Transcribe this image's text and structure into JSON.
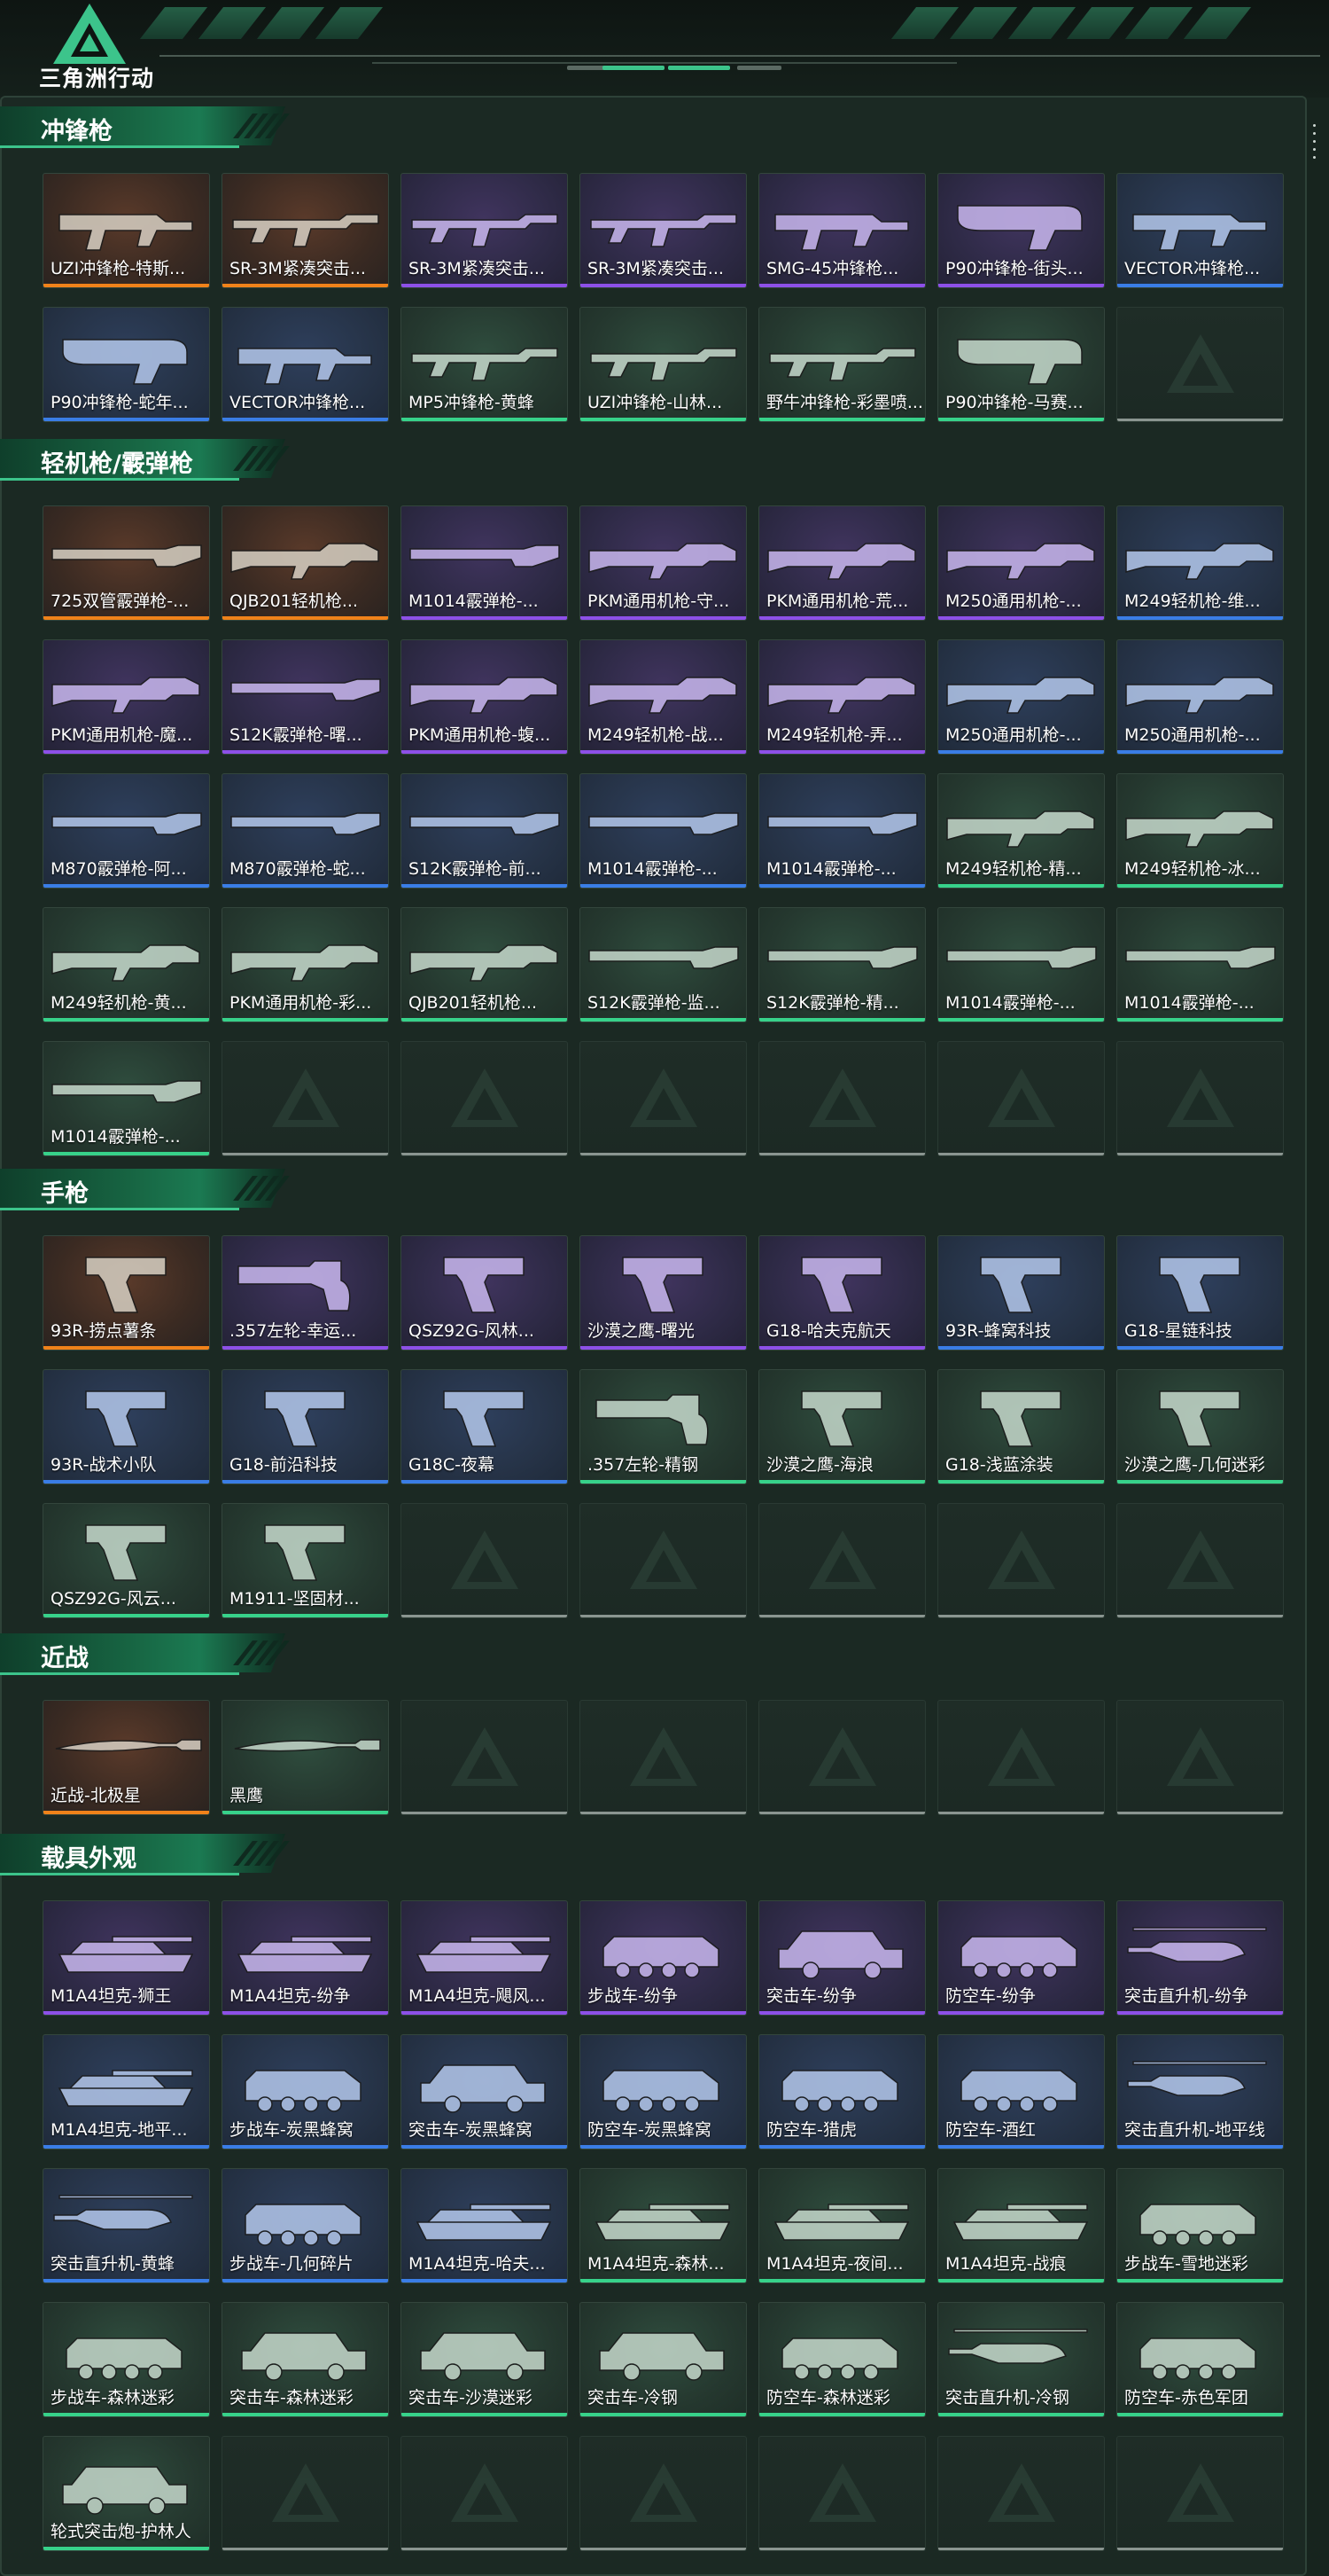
{
  "app": {
    "logo_text": "三角洲行动"
  },
  "colors": {
    "orange": "#f0821a",
    "purple": "#8d50e8",
    "blue": "#3a7de6",
    "green": "#37d28a",
    "empty": "#8a9590",
    "accent": "#1b7a52"
  },
  "sections": [
    {
      "title": "冲锋枪",
      "items": [
        {
          "name": "UZI冲锋枪-特斯...",
          "rarity": "orange",
          "kind": "smg"
        },
        {
          "name": "SR-3M紧凑突击...",
          "rarity": "orange",
          "kind": "rifle"
        },
        {
          "name": "SR-3M紧凑突击...",
          "rarity": "purple",
          "kind": "rifle"
        },
        {
          "name": "SR-3M紧凑突击...",
          "rarity": "purple",
          "kind": "rifle"
        },
        {
          "name": "SMG-45冲锋枪...",
          "rarity": "purple",
          "kind": "smg"
        },
        {
          "name": "P90冲锋枪-街头...",
          "rarity": "purple",
          "kind": "p90"
        },
        {
          "name": "VECTOR冲锋枪...",
          "rarity": "blue",
          "kind": "smg"
        },
        {
          "name": "P90冲锋枪-蛇年...",
          "rarity": "blue",
          "kind": "p90"
        },
        {
          "name": "VECTOR冲锋枪...",
          "rarity": "blue",
          "kind": "smg"
        },
        {
          "name": "MP5冲锋枪-黄蜂",
          "rarity": "green",
          "kind": "rifle"
        },
        {
          "name": "UZI冲锋枪-山林...",
          "rarity": "green",
          "kind": "rifle"
        },
        {
          "name": "野牛冲锋枪-彩墨喷...",
          "rarity": "green",
          "kind": "rifle"
        },
        {
          "name": "P90冲锋枪-马赛...",
          "rarity": "green",
          "kind": "p90"
        },
        {
          "empty": true
        }
      ]
    },
    {
      "title": "轻机枪/霰弹枪",
      "items": [
        {
          "name": "725双管霰弹枪-...",
          "rarity": "orange",
          "kind": "shotgun"
        },
        {
          "name": "QJB201轻机枪...",
          "rarity": "orange",
          "kind": "lmg"
        },
        {
          "name": "M1014霰弹枪-...",
          "rarity": "purple",
          "kind": "shotgun"
        },
        {
          "name": "PKM通用机枪-守...",
          "rarity": "purple",
          "kind": "lmg"
        },
        {
          "name": "PKM通用机枪-荒...",
          "rarity": "purple",
          "kind": "lmg"
        },
        {
          "name": "M250通用机枪-...",
          "rarity": "purple",
          "kind": "lmg"
        },
        {
          "name": "M249轻机枪-维...",
          "rarity": "blue",
          "kind": "lmg"
        },
        {
          "name": "PKM通用机枪-魔...",
          "rarity": "purple",
          "kind": "lmg"
        },
        {
          "name": "S12K霰弹枪-曙...",
          "rarity": "purple",
          "kind": "shotgun"
        },
        {
          "name": "PKM通用机枪-蝮...",
          "rarity": "purple",
          "kind": "lmg"
        },
        {
          "name": "M249轻机枪-战...",
          "rarity": "purple",
          "kind": "lmg"
        },
        {
          "name": "M249轻机枪-弄...",
          "rarity": "purple",
          "kind": "lmg"
        },
        {
          "name": "M250通用机枪-...",
          "rarity": "blue",
          "kind": "lmg"
        },
        {
          "name": "M250通用机枪-...",
          "rarity": "blue",
          "kind": "lmg"
        },
        {
          "name": "M870霰弹枪-阿...",
          "rarity": "blue",
          "kind": "shotgun"
        },
        {
          "name": "M870霰弹枪-蛇...",
          "rarity": "blue",
          "kind": "shotgun"
        },
        {
          "name": "S12K霰弹枪-前...",
          "rarity": "blue",
          "kind": "shotgun"
        },
        {
          "name": "M1014霰弹枪-...",
          "rarity": "blue",
          "kind": "shotgun"
        },
        {
          "name": "M1014霰弹枪-...",
          "rarity": "blue",
          "kind": "shotgun"
        },
        {
          "name": "M249轻机枪-精...",
          "rarity": "green",
          "kind": "lmg"
        },
        {
          "name": "M249轻机枪-冰...",
          "rarity": "green",
          "kind": "lmg"
        },
        {
          "name": "M249轻机枪-黄...",
          "rarity": "green",
          "kind": "lmg"
        },
        {
          "name": "PKM通用机枪-彩...",
          "rarity": "green",
          "kind": "lmg"
        },
        {
          "name": "QJB201轻机枪...",
          "rarity": "green",
          "kind": "lmg"
        },
        {
          "name": "S12K霰弹枪-监...",
          "rarity": "green",
          "kind": "shotgun"
        },
        {
          "name": "S12K霰弹枪-精...",
          "rarity": "green",
          "kind": "shotgun"
        },
        {
          "name": "M1014霰弹枪-...",
          "rarity": "green",
          "kind": "shotgun"
        },
        {
          "name": "M1014霰弹枪-...",
          "rarity": "green",
          "kind": "shotgun"
        },
        {
          "name": "M1014霰弹枪-...",
          "rarity": "green",
          "kind": "shotgun"
        },
        {
          "empty": true
        },
        {
          "empty": true
        },
        {
          "empty": true
        },
        {
          "empty": true
        },
        {
          "empty": true
        },
        {
          "empty": true
        }
      ]
    },
    {
      "title": "手枪",
      "items": [
        {
          "name": "93R-捞点薯条",
          "rarity": "orange",
          "kind": "pistol"
        },
        {
          "name": ".357左轮-幸运...",
          "rarity": "purple",
          "kind": "revolver"
        },
        {
          "name": "QSZ92G-风林...",
          "rarity": "purple",
          "kind": "pistol"
        },
        {
          "name": "沙漠之鹰-曙光",
          "rarity": "purple",
          "kind": "pistol"
        },
        {
          "name": "G18-哈夫克航天",
          "rarity": "purple",
          "kind": "pistol"
        },
        {
          "name": "93R-蜂窝科技",
          "rarity": "blue",
          "kind": "pistol"
        },
        {
          "name": "G18-星链科技",
          "rarity": "blue",
          "kind": "pistol"
        },
        {
          "name": "93R-战术小队",
          "rarity": "blue",
          "kind": "pistol"
        },
        {
          "name": "G18-前沿科技",
          "rarity": "blue",
          "kind": "pistol"
        },
        {
          "name": "G18C-夜幕",
          "rarity": "blue",
          "kind": "pistol"
        },
        {
          "name": ".357左轮-精钢",
          "rarity": "green",
          "kind": "revolver"
        },
        {
          "name": "沙漠之鹰-海浪",
          "rarity": "green",
          "kind": "pistol"
        },
        {
          "name": "G18-浅蓝涂装",
          "rarity": "green",
          "kind": "pistol"
        },
        {
          "name": "沙漠之鹰-几何迷彩",
          "rarity": "green",
          "kind": "pistol"
        },
        {
          "name": "QSZ92G-风云...",
          "rarity": "green",
          "kind": "pistol"
        },
        {
          "name": "M1911-坚固材...",
          "rarity": "green",
          "kind": "pistol"
        },
        {
          "empty": true
        },
        {
          "empty": true
        },
        {
          "empty": true
        },
        {
          "empty": true
        },
        {
          "empty": true
        }
      ]
    },
    {
      "title": "近战",
      "items": [
        {
          "name": "近战-北极星",
          "rarity": "orange",
          "kind": "knife"
        },
        {
          "name": "黑鹰",
          "rarity": "green",
          "kind": "knife"
        },
        {
          "empty": true
        },
        {
          "empty": true
        },
        {
          "empty": true
        },
        {
          "empty": true
        },
        {
          "empty": true
        }
      ]
    },
    {
      "title": "载具外观",
      "items": [
        {
          "name": "M1A4坦克-狮王",
          "rarity": "purple",
          "kind": "tank"
        },
        {
          "name": "M1A4坦克-纷争",
          "rarity": "purple",
          "kind": "tank"
        },
        {
          "name": "M1A4坦克-飓风...",
          "rarity": "purple",
          "kind": "tank"
        },
        {
          "name": "步战车-纷争",
          "rarity": "purple",
          "kind": "ifv"
        },
        {
          "name": "突击车-纷争",
          "rarity": "purple",
          "kind": "car"
        },
        {
          "name": "防空车-纷争",
          "rarity": "purple",
          "kind": "ifv"
        },
        {
          "name": "突击直升机-纷争",
          "rarity": "purple",
          "kind": "heli"
        },
        {
          "name": "M1A4坦克-地平...",
          "rarity": "blue",
          "kind": "tank"
        },
        {
          "name": "步战车-炭黑蜂窝",
          "rarity": "blue",
          "kind": "ifv"
        },
        {
          "name": "突击车-炭黑蜂窝",
          "rarity": "blue",
          "kind": "car"
        },
        {
          "name": "防空车-炭黑蜂窝",
          "rarity": "blue",
          "kind": "ifv"
        },
        {
          "name": "防空车-猎虎",
          "rarity": "blue",
          "kind": "ifv"
        },
        {
          "name": "防空车-酒红",
          "rarity": "blue",
          "kind": "ifv"
        },
        {
          "name": "突击直升机-地平线",
          "rarity": "blue",
          "kind": "heli"
        },
        {
          "name": "突击直升机-黄蜂",
          "rarity": "blue",
          "kind": "heli"
        },
        {
          "name": "步战车-几何碎片",
          "rarity": "blue",
          "kind": "ifv"
        },
        {
          "name": "M1A4坦克-哈夫...",
          "rarity": "blue",
          "kind": "tank"
        },
        {
          "name": "M1A4坦克-森林...",
          "rarity": "green",
          "kind": "tank"
        },
        {
          "name": "M1A4坦克-夜间...",
          "rarity": "green",
          "kind": "tank"
        },
        {
          "name": "M1A4坦克-战痕",
          "rarity": "green",
          "kind": "tank"
        },
        {
          "name": "步战车-雪地迷彩",
          "rarity": "green",
          "kind": "ifv"
        },
        {
          "name": "步战车-森林迷彩",
          "rarity": "green",
          "kind": "ifv"
        },
        {
          "name": "突击车-森林迷彩",
          "rarity": "green",
          "kind": "car"
        },
        {
          "name": "突击车-沙漠迷彩",
          "rarity": "green",
          "kind": "car"
        },
        {
          "name": "突击车-冷钢",
          "rarity": "green",
          "kind": "car"
        },
        {
          "name": "防空车-森林迷彩",
          "rarity": "green",
          "kind": "ifv"
        },
        {
          "name": "突击直升机-冷钢",
          "rarity": "green",
          "kind": "heli"
        },
        {
          "name": "防空车-赤色军团",
          "rarity": "green",
          "kind": "ifv"
        },
        {
          "name": "轮式突击炮-护林人",
          "rarity": "green",
          "kind": "car"
        },
        {
          "empty": true
        },
        {
          "empty": true
        },
        {
          "empty": true
        },
        {
          "empty": true
        },
        {
          "empty": true
        },
        {
          "empty": true
        }
      ]
    }
  ]
}
